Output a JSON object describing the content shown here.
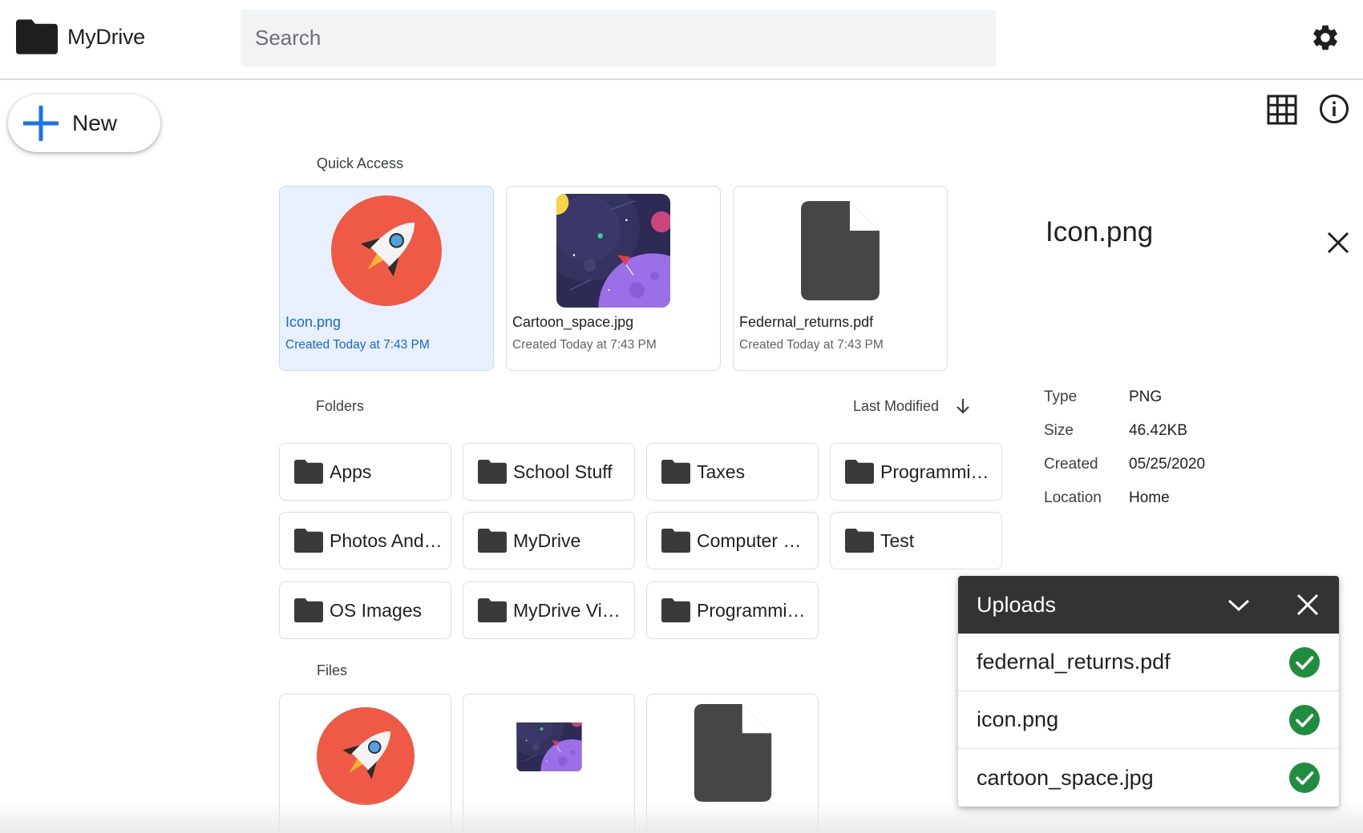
{
  "app": {
    "name": "MyDrive"
  },
  "search": {
    "placeholder": "Search",
    "value": ""
  },
  "icons": {
    "logo": "folder-icon",
    "settings": "gear-icon",
    "new": "plus-icon",
    "view": "grid-view-icon",
    "info": "info-icon",
    "close": "close-icon",
    "sort": "arrow-down-icon",
    "folder": "folder-icon",
    "collapse": "chevron-down-icon",
    "done": "check-circle-icon"
  },
  "new_button": {
    "label": "New"
  },
  "colors": {
    "accent": "#1a73e8",
    "selected_bg": "#e8f0fe",
    "selected_text": "#1967d2",
    "rocket_bg": "#ee5a45",
    "success": "#1e8e3e",
    "uploads_header": "#333333"
  },
  "quick_access": {
    "label": "Quick Access",
    "items": [
      {
        "name": "Icon.png",
        "meta": "Created Today at 7:43 PM",
        "thumb": "rocket-icon",
        "selected": true
      },
      {
        "name": "Cartoon_space.jpg",
        "meta": "Created Today at 7:43 PM",
        "thumb": "space-image",
        "selected": false
      },
      {
        "name": "Federnal_returns.pdf",
        "meta": "Created Today at 7:43 PM",
        "thumb": "document-icon",
        "selected": false
      }
    ]
  },
  "folders": {
    "label": "Folders",
    "sort_label": "Last Modified",
    "items": [
      {
        "name": "Apps"
      },
      {
        "name": "School Stuff"
      },
      {
        "name": "Taxes"
      },
      {
        "name": "Programmi…"
      },
      {
        "name": "Photos And…"
      },
      {
        "name": "MyDrive"
      },
      {
        "name": "Computer …"
      },
      {
        "name": "Test"
      },
      {
        "name": "OS Images"
      },
      {
        "name": "MyDrive Vi…"
      },
      {
        "name": "Programmi…"
      }
    ]
  },
  "files": {
    "label": "Files",
    "items": [
      {
        "thumb": "rocket-icon"
      },
      {
        "thumb": "space-image"
      },
      {
        "thumb": "document-icon"
      }
    ]
  },
  "details": {
    "title": "Icon.png",
    "rows": [
      {
        "key": "Type",
        "value": "PNG"
      },
      {
        "key": "Size",
        "value": "46.42KB"
      },
      {
        "key": "Created",
        "value": "05/25/2020"
      },
      {
        "key": "Location",
        "value": "Home"
      }
    ]
  },
  "uploads": {
    "title": "Uploads",
    "items": [
      {
        "name": "federnal_returns.pdf",
        "status": "complete"
      },
      {
        "name": "icon.png",
        "status": "complete"
      },
      {
        "name": "cartoon_space.jpg",
        "status": "complete"
      }
    ]
  }
}
